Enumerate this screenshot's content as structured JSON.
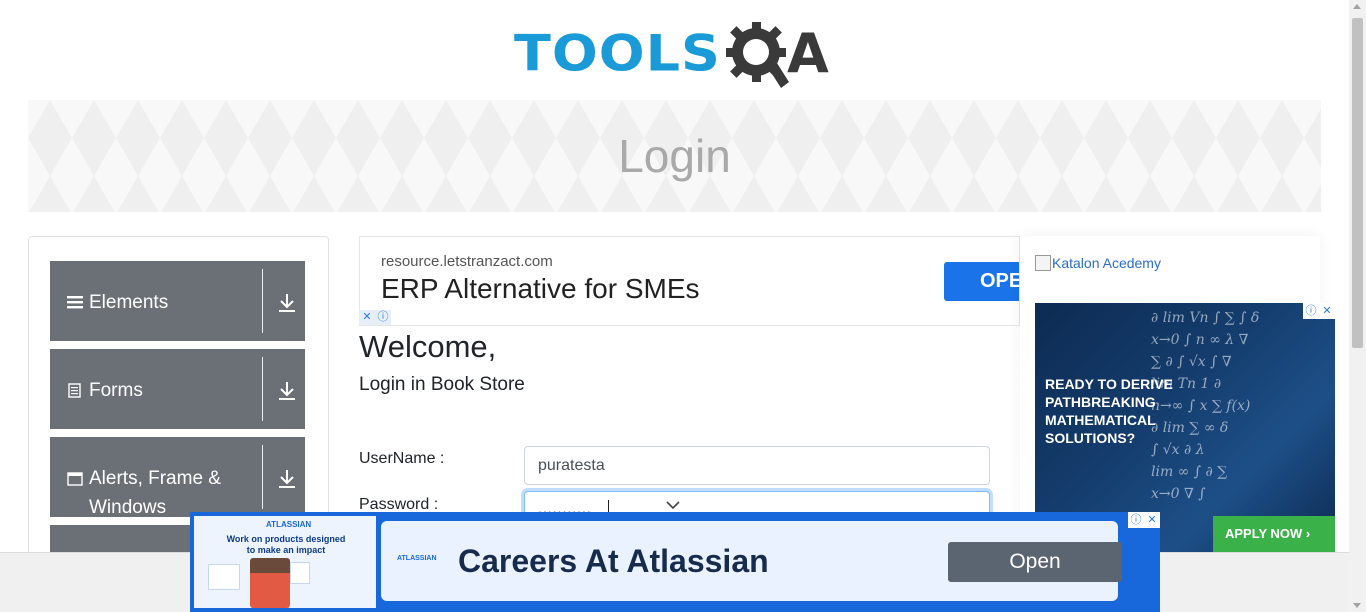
{
  "header": {
    "logo_tools": "TOOLS",
    "logo_a": "A"
  },
  "banner": {
    "title": "Login"
  },
  "sidebar": {
    "groups": [
      {
        "label": "Elements",
        "icon": "hamburger-icon"
      },
      {
        "label": "Forms",
        "icon": "document-icon"
      },
      {
        "label": "Alerts, Frame & Windows",
        "icon": "window-icon"
      },
      {
        "label": "",
        "icon": ""
      }
    ]
  },
  "ad_top": {
    "url": "resource.letstranzact.com",
    "headline": "ERP Alternative for SMEs",
    "cta": "OPE"
  },
  "main": {
    "welcome": "Welcome,",
    "subtitle": "Login in Book Store",
    "username_label": "UserName :",
    "username_value": "puratesta",
    "password_label": "Password :",
    "password_value": "...........",
    "chevron_icon": "chevron-down-icon"
  },
  "right_ad": {
    "image_alt": "Katalon Acedemy",
    "headline": "READY TO DERIVE PATHBREAKING MATHEMATICAL SOLUTIONS?",
    "cta": "APPLY NOW ›"
  },
  "bottom_ad": {
    "thumb_brand": "ATLASSIAN",
    "thumb_tagline": "Work on products designed to make an impact",
    "brand": "ATLASSIAN",
    "title": "Careers At Atlassian",
    "cta": "Open"
  },
  "ad_icons": {
    "close": "✕",
    "info": "ⓘ"
  },
  "colors": {
    "brand_blue": "#1a9ad6",
    "sidebar_gray": "#6b7077",
    "ad_blue": "#1868db",
    "apply_green": "#3bb14a",
    "open_button": "#5b6571"
  }
}
